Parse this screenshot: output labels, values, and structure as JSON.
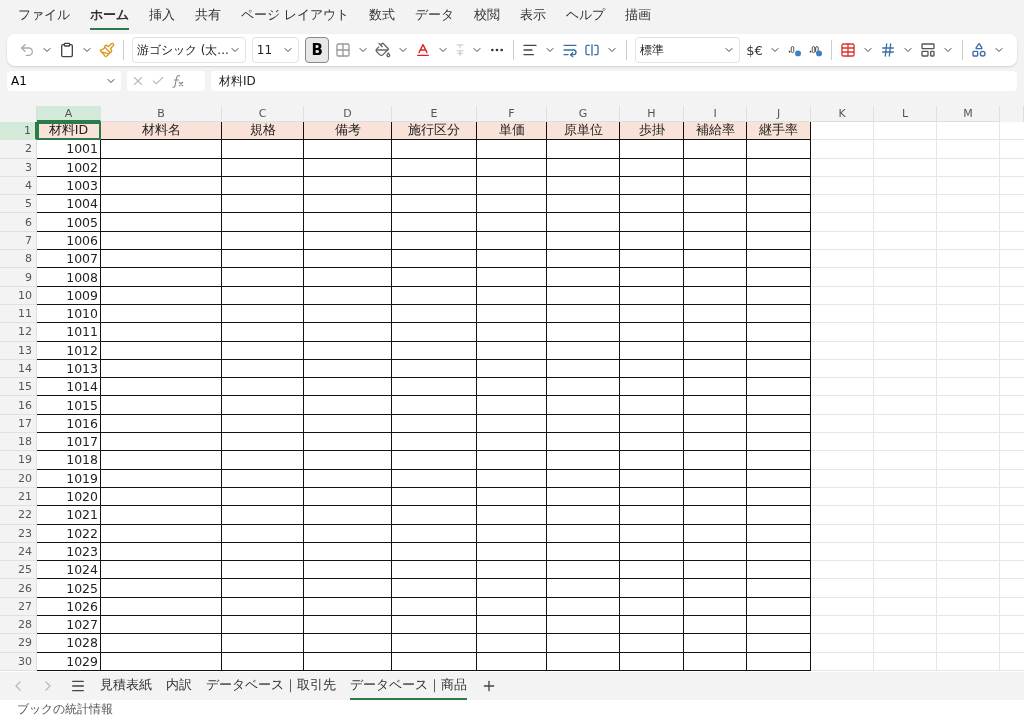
{
  "ribbon_tabs": [
    {
      "label": "ファイル",
      "selected": false
    },
    {
      "label": "ホーム",
      "selected": true
    },
    {
      "label": "挿入",
      "selected": false
    },
    {
      "label": "共有",
      "selected": false
    },
    {
      "label": "ページ レイアウト",
      "selected": false
    },
    {
      "label": "数式",
      "selected": false
    },
    {
      "label": "データ",
      "selected": false
    },
    {
      "label": "校閲",
      "selected": false
    },
    {
      "label": "表示",
      "selected": false
    },
    {
      "label": "ヘルプ",
      "selected": false
    },
    {
      "label": "描画",
      "selected": false
    }
  ],
  "toolbar": {
    "font_name": "游ゴシック (太...",
    "font_size": "11",
    "bold": {
      "label": "B",
      "selected": true
    },
    "number_format": "標準",
    "currency": "$€"
  },
  "formula_bar": {
    "name_box": "A1",
    "value": "材料ID"
  },
  "sheet": {
    "columns": [
      {
        "label": "A",
        "selected": true
      },
      {
        "label": "B",
        "selected": false
      },
      {
        "label": "C",
        "selected": false
      },
      {
        "label": "D",
        "selected": false
      },
      {
        "label": "E",
        "selected": false
      },
      {
        "label": "F",
        "selected": false
      },
      {
        "label": "G",
        "selected": false
      },
      {
        "label": "H",
        "selected": false
      },
      {
        "label": "I",
        "selected": false
      },
      {
        "label": "J",
        "selected": false
      },
      {
        "label": "K",
        "selected": false
      },
      {
        "label": "L",
        "selected": false
      },
      {
        "label": "M",
        "selected": false
      }
    ],
    "header_row": {
      "number": "1",
      "selected": true,
      "cells": [
        "材料ID",
        "材料名",
        "規格",
        "備考",
        "施行区分",
        "単価",
        "原単位",
        "歩掛",
        "補給率",
        "継手率"
      ]
    },
    "rows": [
      {
        "number": "2",
        "id": "1001"
      },
      {
        "number": "3",
        "id": "1002"
      },
      {
        "number": "4",
        "id": "1003"
      },
      {
        "number": "5",
        "id": "1004"
      },
      {
        "number": "6",
        "id": "1005"
      },
      {
        "number": "7",
        "id": "1006"
      },
      {
        "number": "8",
        "id": "1007"
      },
      {
        "number": "9",
        "id": "1008"
      },
      {
        "number": "10",
        "id": "1009"
      },
      {
        "number": "11",
        "id": "1010"
      },
      {
        "number": "12",
        "id": "1011"
      },
      {
        "number": "13",
        "id": "1012"
      },
      {
        "number": "14",
        "id": "1013"
      },
      {
        "number": "15",
        "id": "1014"
      },
      {
        "number": "16",
        "id": "1015"
      },
      {
        "number": "17",
        "id": "1016"
      },
      {
        "number": "18",
        "id": "1017"
      },
      {
        "number": "19",
        "id": "1018"
      },
      {
        "number": "20",
        "id": "1019"
      },
      {
        "number": "21",
        "id": "1020"
      },
      {
        "number": "22",
        "id": "1021"
      },
      {
        "number": "23",
        "id": "1022"
      },
      {
        "number": "24",
        "id": "1023"
      },
      {
        "number": "25",
        "id": "1024"
      },
      {
        "number": "26",
        "id": "1025"
      },
      {
        "number": "27",
        "id": "1026"
      },
      {
        "number": "28",
        "id": "1027"
      },
      {
        "number": "29",
        "id": "1028"
      },
      {
        "number": "30",
        "id": "1029"
      }
    ]
  },
  "sheet_tabs": [
    {
      "label": "見積表紙",
      "selected": false
    },
    {
      "label": "内訳",
      "selected": false
    },
    {
      "label": "データベース｜取引先",
      "selected": false
    },
    {
      "label": "データベース｜商品",
      "selected": true
    }
  ],
  "status_bar": "ブックの統計情報"
}
